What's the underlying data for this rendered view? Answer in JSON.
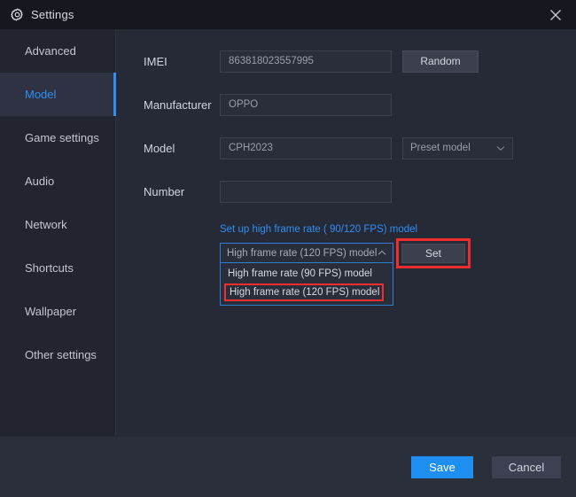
{
  "window": {
    "title": "Settings",
    "gear_icon": "gear-icon",
    "close_icon": "close-icon"
  },
  "sidebar": {
    "items": [
      {
        "label": "Advanced",
        "active": false
      },
      {
        "label": "Model",
        "active": true
      },
      {
        "label": "Game settings",
        "active": false
      },
      {
        "label": "Audio",
        "active": false
      },
      {
        "label": "Network",
        "active": false
      },
      {
        "label": "Shortcuts",
        "active": false
      },
      {
        "label": "Wallpaper",
        "active": false
      },
      {
        "label": "Other settings",
        "active": false
      }
    ]
  },
  "form": {
    "imei": {
      "label": "IMEI",
      "value": "863818023557995",
      "placeholder": "",
      "button_label": "Random"
    },
    "manufacturer": {
      "label": "Manufacturer",
      "value": "OPPO",
      "placeholder": ""
    },
    "model": {
      "label": "Model",
      "value": "CPH2023",
      "placeholder": "",
      "preset_label": "Preset model",
      "preset_chevron": "chevron-down-icon"
    },
    "number": {
      "label": "Number",
      "value": "",
      "placeholder": ""
    }
  },
  "high_frame_rate": {
    "link_label": "Set up high frame rate ( 90/120 FPS) model",
    "selected": "High frame rate (120 FPS) model",
    "chevron": "chevron-up-icon",
    "options": [
      {
        "label": "High frame rate (90 FPS) model",
        "highlighted": false
      },
      {
        "label": "High frame rate (120 FPS) model",
        "highlighted": true
      }
    ],
    "set_button_label": "Set"
  },
  "footer": {
    "save_label": "Save",
    "cancel_label": "Cancel"
  },
  "colors": {
    "accent_blue": "#2e90f5",
    "primary_button": "#1f8ef1",
    "annotation_red": "#ef2d2d",
    "window_bg": "#262936",
    "sidebar_bg": "#22242f",
    "titlebar_bg": "#16181f"
  }
}
